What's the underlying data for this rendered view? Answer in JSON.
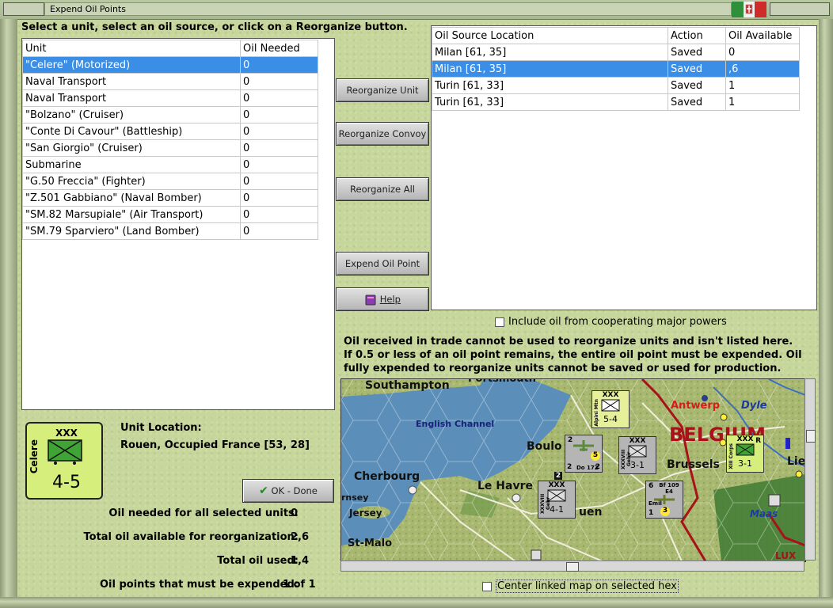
{
  "window": {
    "title": "Expend Oil Points"
  },
  "instruction": "Select a unit, select an oil source, or click on a Reorganize button.",
  "units_table": {
    "headers": [
      "Unit",
      "Oil Needed"
    ],
    "rows": [
      {
        "unit": "\"Celere\" (Motorized)",
        "oil": "0"
      },
      {
        "unit": "Naval Transport",
        "oil": "0"
      },
      {
        "unit": "Naval Transport",
        "oil": "0"
      },
      {
        "unit": "\"Bolzano\" (Cruiser)",
        "oil": "0"
      },
      {
        "unit": "\"Conte Di Cavour\" (Battleship)",
        "oil": "0"
      },
      {
        "unit": "\"San Giorgio\" (Cruiser)",
        "oil": "0"
      },
      {
        "unit": "Submarine",
        "oil": "0"
      },
      {
        "unit": "\"G.50 Freccia\" (Fighter)",
        "oil": "0"
      },
      {
        "unit": "\"Z.501 Gabbiano\" (Naval Bomber)",
        "oil": "0"
      },
      {
        "unit": "\"SM.82 Marsupiale\" (Air Transport)",
        "oil": "0"
      },
      {
        "unit": "\"SM.79 Sparviero\" (Land Bomber)",
        "oil": "0"
      }
    ]
  },
  "sources_table": {
    "headers": [
      "Oil Source Location",
      "Action",
      "Oil Available"
    ],
    "rows": [
      {
        "loc": "Milan [61, 35]",
        "action": "Saved",
        "oil": "0"
      },
      {
        "loc": "Milan [61, 35]",
        "action": "Saved",
        "oil": ",6"
      },
      {
        "loc": "Turin [61, 33]",
        "action": "Saved",
        "oil": "1"
      },
      {
        "loc": "Turin [61, 33]",
        "action": "Saved",
        "oil": "1"
      }
    ]
  },
  "buttons": {
    "reorg_unit": "Reorganize Unit",
    "reorg_convoy": "Reorganize Convoy",
    "reorg_all": "Reorganize All",
    "expend": "Expend Oil Point",
    "help": "Help",
    "ok": "OK - Done"
  },
  "include_coop_label": "Include oil from cooperating major powers",
  "note": "Oil received in trade cannot be used to reorganize units and isn't listed here.  If 0.5 or less of an oil point remains, the entire oil point must be expended.   Oil fully expended to reorganize units cannot be saved or used for production.",
  "unit_counter": {
    "name": "Celere",
    "size": "XXX",
    "strength": "4-5",
    "color": "#d6ee7c"
  },
  "unit_location": {
    "label": "Unit Location:",
    "value": "Rouen, Occupied France [53, 28]"
  },
  "stats": [
    {
      "label": "Oil needed for all selected units:",
      "value": "0"
    },
    {
      "label": "Total oil available for reorganization:",
      "value": "2,6"
    },
    {
      "label": "Total oil used:",
      "value": "1,4"
    },
    {
      "label": "Oil points that must be expended:",
      "value": "1 of 1"
    }
  ],
  "center_map_label": "Center linked map on selected hex",
  "map": {
    "labels": {
      "southampton": "Southampton",
      "portsmouth": "Portsmouth",
      "channel": "English Channel",
      "antwerp": "Antwerp",
      "dyle": "Dyle",
      "belgium": "BELGIUM",
      "boulogne": "Boulo",
      "brussels": "Brussels",
      "liege": "Lie",
      "cherbourg": "Cherbourg",
      "lehavre": "Le Havre",
      "guernsey": "rnsey",
      "jersey": "Jersey",
      "rouen": "uen",
      "maas": "Maas",
      "stmalo": "St-Malo",
      "lux": "LUX"
    },
    "counters": {
      "alpini": {
        "name": "Alpini Mtn",
        "size": "XXX",
        "strength": "5-4"
      },
      "do17": {
        "top": "2",
        "label": "Do 17Z",
        "bottom": "2",
        "num": "5",
        "mid": "2"
      },
      "xxxviii": {
        "name": "XXXVIII Gebir",
        "size": "XXX",
        "strength": "3-1"
      },
      "xiii": {
        "name": "XIII Corps",
        "size": "XXX",
        "strength": "3-1",
        "tag": "R"
      },
      "xxxviii2": {
        "name": "XXXVIII Gebr",
        "size": "XXX",
        "strength": "4-1",
        "stack": "2"
      },
      "bf109": {
        "top": "6",
        "label": "Bf 109 E4",
        "sub": "Emil",
        "bottom": "1",
        "num": "3"
      }
    }
  }
}
